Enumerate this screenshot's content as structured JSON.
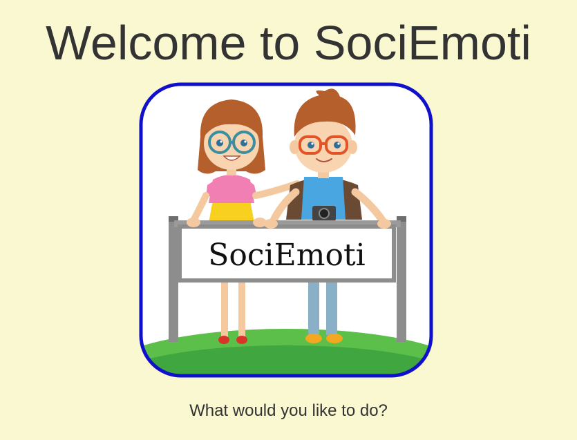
{
  "header": {
    "title": "Welcome to SociEmoti"
  },
  "logo": {
    "sign_text": "SociEmoti",
    "border_color": "#1010cc"
  },
  "main": {
    "prompt": "What would you like to do?"
  },
  "colors": {
    "background": "#faf8d0",
    "text": "#333333"
  }
}
